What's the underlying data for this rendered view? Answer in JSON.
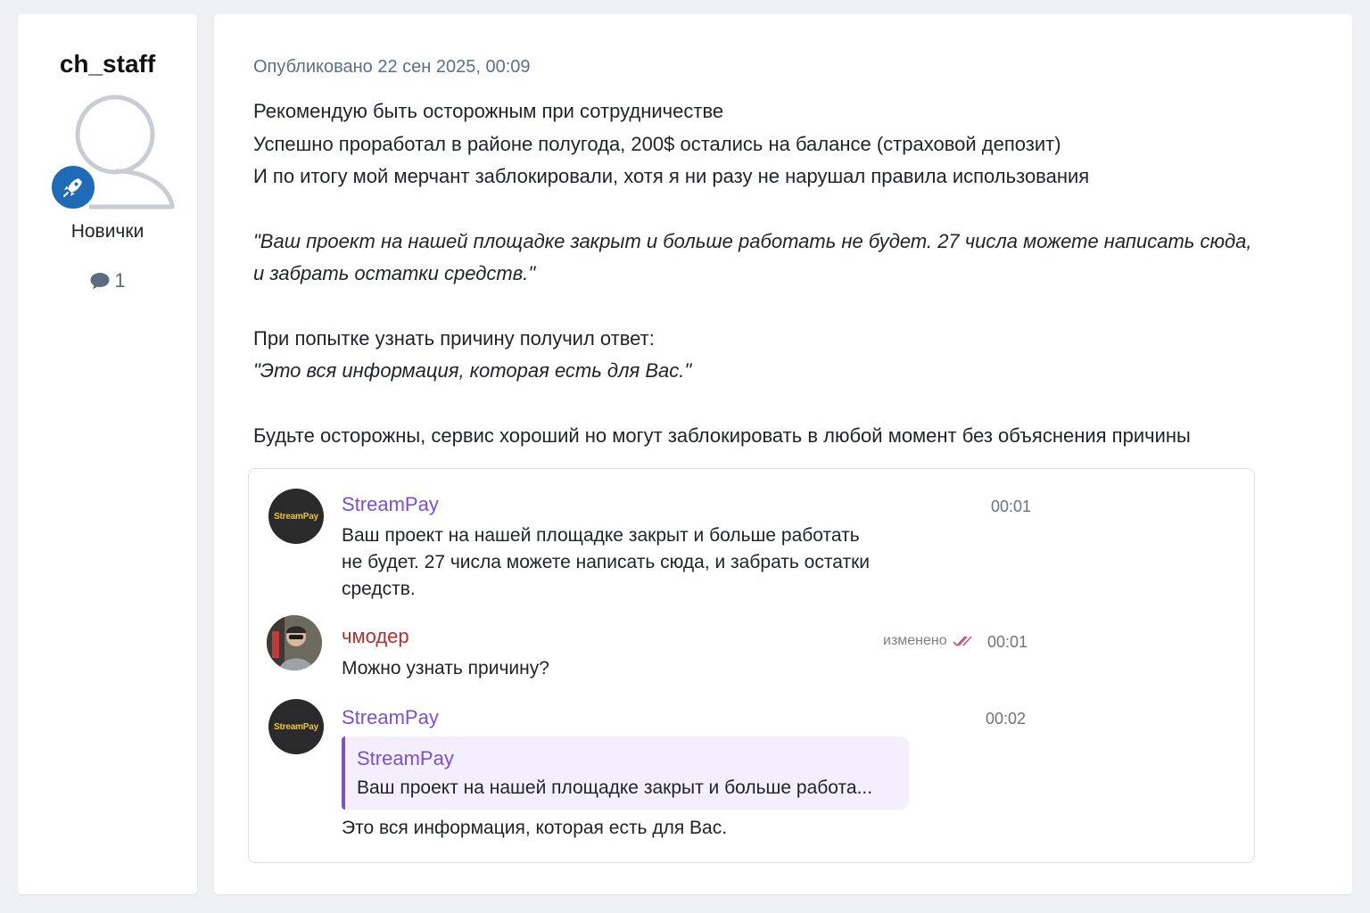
{
  "author": {
    "username": "ch_staff",
    "group": "Новички",
    "post_count": "1",
    "badge_icon": "rocket-icon",
    "accent_color": "#1f6bb8"
  },
  "post": {
    "date": "Опубликовано 22 сен 2025, 00:09",
    "paragraphs": {
      "p1_line1": "Рекомендую быть осторожным при сотрудничестве",
      "p1_line2": "Успешно проработал в районе полугода, 200$ остались на балансе (страховой депозит)",
      "p1_line3": "И по итогу мой мерчант заблокировали, хотя я ни разу не нарушал правила использования",
      "quote1_line1": "\"Ваш проект на нашей площадке закрыт и больше работать не будет. 27 числа можете написать сюда,",
      "quote1_line2": "и забрать остатки средств.\"",
      "p3_line1": "При попытке узнать причину получил ответ:",
      "quote2": "\"Это вся информация, которая есть для Вас.\"",
      "p4": "Будьте осторожны, сервис хороший но могут заблокировать в любой момент без объяснения причины"
    }
  },
  "chat": {
    "messages": [
      {
        "avatar_text": "StreamPay",
        "author": "StreamPay",
        "time": "00:01",
        "text_line1": "Ваш проект на нашей площадке закрыт и больше работать",
        "text_line2": "не будет. 27 числа можете написать сюда, и забрать остатки",
        "text_line3": "средств."
      },
      {
        "author": "чмодер",
        "edited_label": "изменено",
        "time": "00:01",
        "text": "Можно узнать причину?"
      },
      {
        "avatar_text": "StreamPay",
        "author": "StreamPay",
        "time": "00:02",
        "reply_author": "StreamPay",
        "reply_text": "Ваш проект на нашей площадке  закрыт и больше работа...",
        "text": "Это вся информация, которая есть для Вас."
      }
    ],
    "colors": {
      "bot_name": "#7a4fd6",
      "user_name": "#b3302c",
      "logo_text": "#f5c518"
    }
  }
}
